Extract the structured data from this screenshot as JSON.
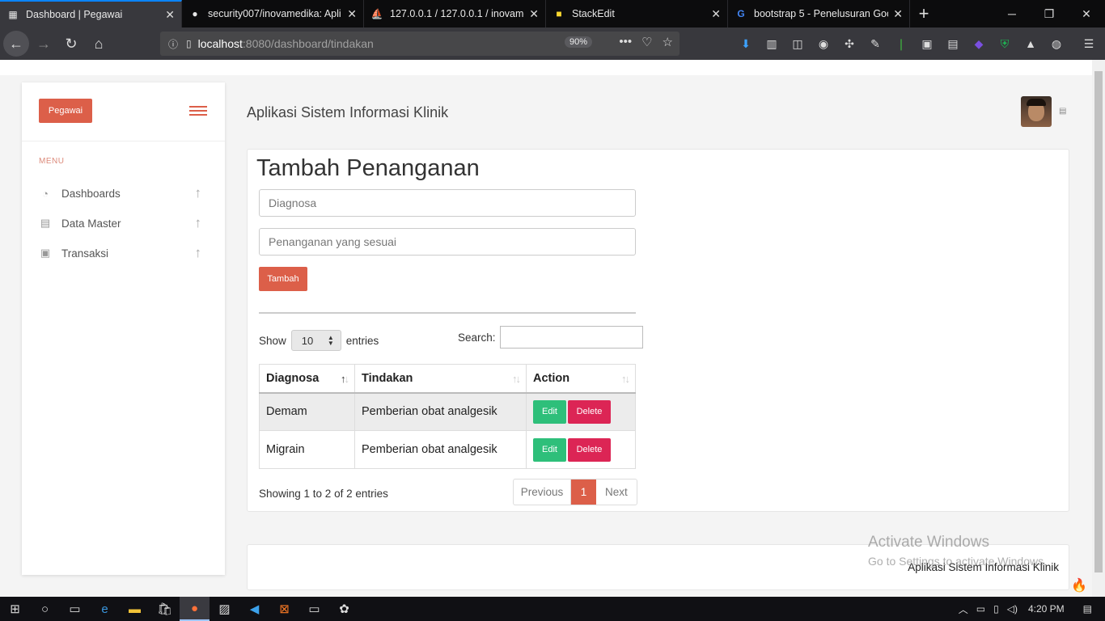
{
  "browser": {
    "tabs": [
      {
        "title": "Dashboard | Pegawai",
        "icon": "dashboard-icon",
        "active": true
      },
      {
        "title": "security007/inovamedika: Apli",
        "icon": "github-icon",
        "active": false
      },
      {
        "title": "127.0.0.1 / 127.0.0.1 / inovamed",
        "icon": "phpmyadmin-icon",
        "active": false
      },
      {
        "title": "StackEdit",
        "icon": "stackedit-icon",
        "active": false
      },
      {
        "title": "bootstrap 5 - Penelusuran Goo",
        "icon": "google-icon",
        "active": false
      }
    ],
    "url_host": "localhost",
    "url_path": ":8080/dashboard/tindakan",
    "zoom": "90%"
  },
  "sidebar": {
    "brand": "Pegawai",
    "menu_label": "MENU",
    "items": [
      {
        "label": "Dashboards",
        "icon": "gauge-icon"
      },
      {
        "label": "Data Master",
        "icon": "clipboard-icon"
      },
      {
        "label": "Transaksi",
        "icon": "id-card-icon"
      }
    ]
  },
  "header": {
    "title": "Aplikasi Sistem Informasi Klinik"
  },
  "form": {
    "title": "Tambah Penanganan",
    "diagnosa_placeholder": "Diagnosa",
    "penanganan_placeholder": "Penanganan yang sesuai",
    "submit_label": "Tambah"
  },
  "table": {
    "show_label": "Show",
    "length_value": "10",
    "entries_label": "entries",
    "search_label": "Search:",
    "columns": [
      "Diagnosa",
      "Tindakan",
      "Action"
    ],
    "rows": [
      {
        "diagnosa": "Demam",
        "tindakan": "Pemberian obat analgesik"
      },
      {
        "diagnosa": "Migrain",
        "tindakan": "Pemberian obat analgesik"
      }
    ],
    "edit_label": "Edit",
    "delete_label": "Delete",
    "info": "Showing 1 to 2 of 2 entries",
    "pager": {
      "previous": "Previous",
      "current": "1",
      "next": "Next"
    }
  },
  "footer": {
    "text": "Aplikasi Sistem Informasi Klinik"
  },
  "watermark": {
    "line1": "Activate Windows",
    "line2": "Go to Settings to activate Windows."
  },
  "taskbar": {
    "time": "4:20 PM"
  },
  "colors": {
    "accent": "#dc5f49",
    "edit": "#2ebf7a",
    "delete": "#dc2555"
  }
}
